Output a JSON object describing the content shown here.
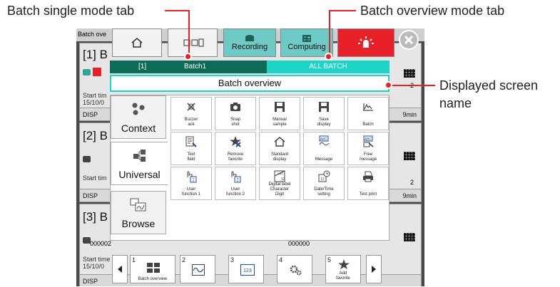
{
  "callouts": {
    "single_tab": "Batch single mode tab",
    "overview_tab": "Batch overview mode tab",
    "screen_name": "Displayed screen",
    "screen_name_2": "name"
  },
  "background": {
    "header_frag": "Batch ove",
    "panels": [
      {
        "title": "[1]  B",
        "time": "Start tim",
        "date": "15/10/0",
        "footer": "DISP",
        "right_min": "9min",
        "right_num": "2"
      },
      {
        "title": "[2]  B",
        "time": "Start tim",
        "date": "",
        "footer": "DISP",
        "right_min": "9min",
        "right_num": "2"
      },
      {
        "title": "[3]  B",
        "time": "Start time :",
        "date": "15/10/0",
        "footer": "DISP",
        "id": "000002",
        "id2": "000000"
      }
    ]
  },
  "toolbar": {
    "recording": "Recording",
    "computing": "Computing"
  },
  "tabs": {
    "single_num": "[1]",
    "single_name": "Batch1",
    "all": "ALL BATCH"
  },
  "screen_name": "Batch overview",
  "categories": [
    "Context",
    "Universal",
    "Browse"
  ],
  "functions": [
    {
      "l1": "Buzzer",
      "l2": "ack",
      "icon": "buzzer-ack-icon"
    },
    {
      "l1": "Snap",
      "l2": "shot",
      "icon": "camera-icon"
    },
    {
      "l1": "Manual",
      "l2": "sample",
      "icon": "floppy-icon"
    },
    {
      "l1": "Save",
      "l2": "display",
      "icon": "floppy-icon"
    },
    {
      "l1": "",
      "l2": "Batch",
      "icon": "batch-trend-icon"
    },
    {
      "l1": "Text",
      "l2": "field",
      "icon": "text-field-icon"
    },
    {
      "l1": "Remove",
      "l2": "favorite",
      "icon": "remove-favorite-icon"
    },
    {
      "l1": "Standard",
      "l2": "display",
      "icon": "home-icon"
    },
    {
      "l1": "",
      "l2": "Message",
      "icon": "message-icon"
    },
    {
      "l1": "Free",
      "l2": "message",
      "icon": "free-message-icon"
    },
    {
      "l1": "User",
      "l2": "function 1",
      "icon": "user-fn1-icon"
    },
    {
      "l1": "User",
      "l2": "function 2",
      "icon": "user-fn2-icon"
    },
    {
      "l1": "Digital label",
      "l2": "Character",
      "l3": "Digit",
      "icon": "digital-label-icon"
    },
    {
      "l1": "Date/Time",
      "l2": "setting",
      "icon": "clock-icon"
    },
    {
      "l1": "",
      "l2": "Test print",
      "icon": "printer-icon"
    }
  ],
  "favorites": [
    {
      "num": "1",
      "label": "Batch overview"
    },
    {
      "num": "2",
      "label": ""
    },
    {
      "num": "3",
      "label": ""
    },
    {
      "num": "4",
      "label": ""
    },
    {
      "num": "5",
      "label": "Add favorite"
    }
  ]
}
